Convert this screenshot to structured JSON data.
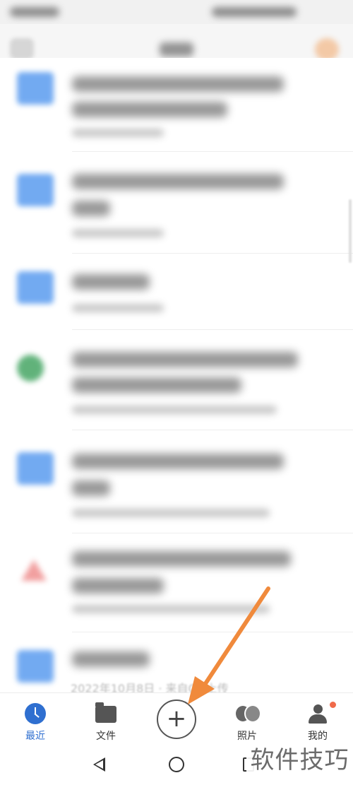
{
  "file_list": {
    "visible_meta": "2022年10月8日 · 来自QQ上传"
  },
  "bottom_nav": {
    "items": [
      {
        "label": "最近",
        "icon": "clock-icon",
        "active": true
      },
      {
        "label": "文件",
        "icon": "folder-icon",
        "active": false
      },
      {
        "label": "照片",
        "icon": "photo-icon",
        "active": false
      },
      {
        "label": "我的",
        "icon": "profile-icon",
        "active": false
      }
    ],
    "add_button": {
      "glyph": "+"
    }
  },
  "watermark": {
    "text": "软件技巧"
  },
  "colors": {
    "accent": "#2f6fd0",
    "arrow": "#f08a3c",
    "folder": "#4f95ee",
    "notification": "#f06a4a"
  }
}
